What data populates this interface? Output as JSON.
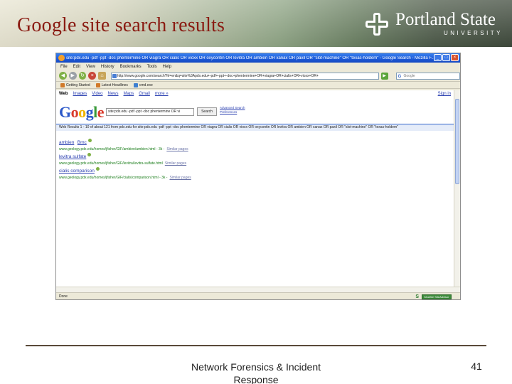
{
  "slide": {
    "title": "Google site search results",
    "logo_name": "Portland State",
    "logo_sub": "UNIVERSITY"
  },
  "browser": {
    "window_title": "site:pdx.edu -pdf -ppt -doc phentermine OR viagra OR cialis OR vioxx OR oxycontin OR levitra OR ambien OR xanax OR paxil OR \"slot-machine\" OR \"texas-holdem\" - Google Search - Mozilla F...",
    "menu": [
      "File",
      "Edit",
      "View",
      "History",
      "Bookmarks",
      "Tools",
      "Help"
    ],
    "url": "http://www.google.com/search?hl=en&q=site%3Apdx.edu+-pdf+-ppt+-doc+phentermine+OR+viagra+OR+cialis+OR+vioxx+OR+",
    "search_placeholder": "Google",
    "bookmarks": [
      "Getting Started",
      "Latest Headlines",
      "cmd.exe"
    ],
    "status": "Done",
    "status_badge": "McAfee SiteAdvisor"
  },
  "google": {
    "tabs": [
      "Web",
      "Images",
      "Video",
      "News",
      "Maps",
      "Gmail",
      "more »"
    ],
    "sign_in": "Sign in",
    "logo_letters": [
      "G",
      "o",
      "o",
      "g",
      "l",
      "e"
    ],
    "query": "site:pdx.edu -pdf -ppt -doc phentermine OR vi",
    "search_button": "Search",
    "advanced_search": "Advanced Search",
    "preferences": "Preferences",
    "results_summary": "Web   Results 1 - 10 of about 121 from pdx.edu for site:pdx.edu -pdf -ppt -doc phentermine OR viagra OR cialis OR vioxx OR oxycontin OR levitra OR ambien OR xanax OR paxil OR \"slot-machine\" OR \"texas-holdem\"",
    "results": [
      {
        "title": "ambien",
        "tail": "Bmc",
        "url": "www.geology.pdx.edu/homes/jfisher/GIF/ambien/ambien.html - 3k -",
        "similar": "Similar pages"
      },
      {
        "title": "levitra sulfate",
        "tail": "",
        "url": "www.geology.pdx.edu/homes/jfisher/GIF/levitra/levitra-sulfate.html",
        "similar": "Similar pages"
      },
      {
        "title": "cialis comparison",
        "tail": "",
        "url": "www.geology.pdx.edu/homes/jfisher/GIF/cialis/comparison.html - 3k -",
        "similar": "Similar pages"
      }
    ]
  },
  "footer": {
    "text": "Network Forensics & Incident Response",
    "page": "41"
  }
}
